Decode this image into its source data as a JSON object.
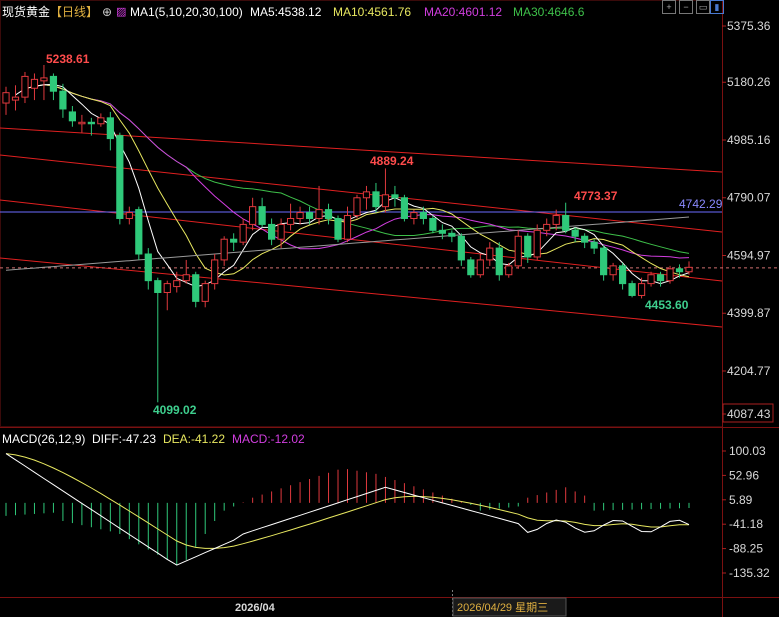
{
  "header": {
    "title": "现货黄金",
    "period": "【日线】",
    "ma_label": "MA1(5,10,20,30,100)",
    "ma5": "MA5:4538.12",
    "ma10": "MA10:4561.76",
    "ma20": "MA20:4601.12",
    "ma30": "MA30:4646.6"
  },
  "macd_header": {
    "label": "MACD(26,12,9)",
    "diff": "DIFF:-47.23",
    "dea": "DEA:-41.22",
    "macd": "MACD:-12.02"
  },
  "colors": {
    "up": "#e0393e",
    "down": "#2fc97a",
    "ma5": "#ffffff",
    "ma10": "#e8e860",
    "ma20": "#d23ee0",
    "ma30": "#3ec04a",
    "ma100": "#9a9a9a",
    "trend": "#e02020",
    "hline": "#6b6bff"
  },
  "chart_data": {
    "type": "candlestick",
    "price_axis": {
      "ticks": [
        "5375.36",
        "5180.26",
        "4985.16",
        "4790.07",
        "4594.97",
        "4399.87",
        "4204.77",
        "4087.43"
      ],
      "ylim": [
        4087.43,
        5375.36
      ]
    },
    "macd_axis": {
      "ticks": [
        "100.03",
        "52.96",
        "5.89",
        "-41.18",
        "-88.25",
        "-135.32"
      ],
      "ylim": [
        -150,
        110
      ]
    },
    "x_labels": [
      "2026/04",
      "2026/04/29 星期三"
    ],
    "annotations": {
      "high": "5238.61",
      "low": "4099.02",
      "peak2": "4889.24",
      "peak3": "4773.37",
      "recent_low": "4453.60",
      "hline_value": "4742.29",
      "current_price": 4553
    },
    "candles": [
      [
        5110,
        5145,
        5070,
        5165
      ],
      [
        5120,
        5130,
        5085,
        5170
      ],
      [
        5130,
        5200,
        5110,
        5215
      ],
      [
        5160,
        5190,
        5120,
        5210
      ],
      [
        5185,
        5195,
        5120,
        5238.61
      ],
      [
        5200,
        5150,
        5120,
        5210
      ],
      [
        5150,
        5090,
        5060,
        5175
      ],
      [
        5080,
        5050,
        5030,
        5100
      ],
      [
        5040,
        5045,
        5010,
        5070
      ],
      [
        5045,
        5040,
        5000,
        5060
      ],
      [
        5040,
        5060,
        5030,
        5075
      ],
      [
        5060,
        4990,
        4950,
        5080
      ],
      [
        5000,
        4720,
        4700,
        5010
      ],
      [
        4720,
        4740,
        4700,
        4760
      ],
      [
        4750,
        4600,
        4580,
        4760
      ],
      [
        4600,
        4510,
        4480,
        4620
      ],
      [
        4510,
        4470,
        4099.02,
        4520
      ],
      [
        4470,
        4500,
        4410,
        4510
      ],
      [
        4490,
        4510,
        4470,
        4540
      ],
      [
        4510,
        4530,
        4500,
        4580
      ],
      [
        4530,
        4440,
        4420,
        4540
      ],
      [
        4440,
        4500,
        4420,
        4510
      ],
      [
        4500,
        4580,
        4480,
        4600
      ],
      [
        4580,
        4650,
        4560,
        4660
      ],
      [
        4650,
        4640,
        4610,
        4670
      ],
      [
        4640,
        4700,
        4630,
        4720
      ],
      [
        4700,
        4760,
        4680,
        4790
      ],
      [
        4760,
        4700,
        4690,
        4790
      ],
      [
        4700,
        4650,
        4630,
        4720
      ],
      [
        4650,
        4700,
        4620,
        4720
      ],
      [
        4700,
        4720,
        4680,
        4770
      ],
      [
        4720,
        4740,
        4700,
        4760
      ],
      [
        4740,
        4720,
        4700,
        4760
      ],
      [
        4720,
        4750,
        4700,
        4830
      ],
      [
        4750,
        4720,
        4700,
        4770
      ],
      [
        4720,
        4650,
        4640,
        4730
      ],
      [
        4650,
        4730,
        4640,
        4760
      ],
      [
        4730,
        4790,
        4720,
        4800
      ],
      [
        4790,
        4810,
        4750,
        4830
      ],
      [
        4810,
        4760,
        4740,
        4840
      ],
      [
        4760,
        4800,
        4740,
        4889.24
      ],
      [
        4800,
        4790,
        4760,
        4830
      ],
      [
        4790,
        4720,
        4710,
        4800
      ],
      [
        4720,
        4740,
        4700,
        4750
      ],
      [
        4740,
        4720,
        4700,
        4760
      ],
      [
        4720,
        4680,
        4670,
        4730
      ],
      [
        4680,
        4670,
        4650,
        4700
      ],
      [
        4670,
        4660,
        4640,
        4680
      ],
      [
        4660,
        4580,
        4560,
        4670
      ],
      [
        4580,
        4530,
        4520,
        4590
      ],
      [
        4530,
        4580,
        4520,
        4600
      ],
      [
        4580,
        4620,
        4560,
        4640
      ],
      [
        4620,
        4530,
        4510,
        4640
      ],
      [
        4530,
        4560,
        4520,
        4570
      ],
      [
        4560,
        4660,
        4550,
        4680
      ],
      [
        4660,
        4590,
        4570,
        4670
      ],
      [
        4590,
        4680,
        4580,
        4700
      ],
      [
        4680,
        4700,
        4660,
        4720
      ],
      [
        4700,
        4730,
        4680,
        4750
      ],
      [
        4730,
        4680,
        4670,
        4773.37
      ],
      [
        4680,
        4660,
        4640,
        4690
      ],
      [
        4660,
        4640,
        4620,
        4670
      ],
      [
        4640,
        4620,
        4600,
        4650
      ],
      [
        4620,
        4530,
        4510,
        4630
      ],
      [
        4530,
        4560,
        4510,
        4570
      ],
      [
        4560,
        4500,
        4480,
        4570
      ],
      [
        4500,
        4460,
        4453.6,
        4510
      ],
      [
        4460,
        4500,
        4450,
        4520
      ],
      [
        4500,
        4530,
        4490,
        4540
      ],
      [
        4530,
        4510,
        4490,
        4540
      ],
      [
        4510,
        4550,
        4500,
        4560
      ],
      [
        4550,
        4540,
        4520,
        4565
      ],
      [
        4540,
        4555,
        4530,
        4575
      ]
    ]
  }
}
